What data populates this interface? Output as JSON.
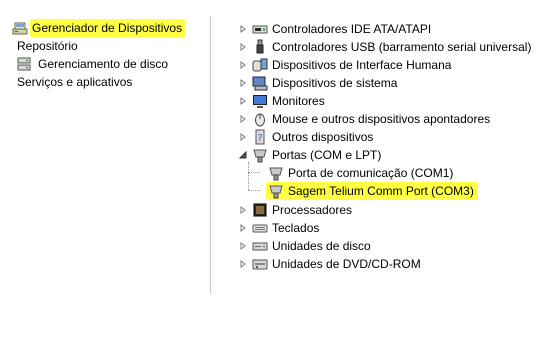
{
  "left_panel": {
    "items": [
      {
        "label": "Gerenciador de Dispositivos",
        "icon": "device-manager-icon",
        "selected": true
      },
      {
        "label": "Repositório",
        "icon": null
      },
      {
        "label": "Gerenciamento de disco",
        "icon": "disk-management-icon"
      },
      {
        "label": "Serviços e aplicativos",
        "icon": null
      }
    ]
  },
  "device_tree": {
    "categories": [
      {
        "label": "Controladores IDE ATA/ATAPI",
        "icon": "ide-controller-icon",
        "expanded": false
      },
      {
        "label": "Controladores USB (barramento serial universal)",
        "icon": "usb-icon",
        "expanded": false
      },
      {
        "label": "Dispositivos de Interface Humana",
        "icon": "hid-icon",
        "expanded": false
      },
      {
        "label": "Dispositivos de sistema",
        "icon": "system-device-icon",
        "expanded": false
      },
      {
        "label": "Monitores",
        "icon": "monitor-icon",
        "expanded": false
      },
      {
        "label": "Mouse e outros dispositivos apontadores",
        "icon": "mouse-icon",
        "expanded": false
      },
      {
        "label": "Outros dispositivos",
        "icon": "unknown-device-icon",
        "expanded": false
      },
      {
        "label": "Portas (COM e LPT)",
        "icon": "port-icon",
        "expanded": true
      },
      {
        "label": "Porta de comunicação (COM1)",
        "icon": "port-icon",
        "child": true
      },
      {
        "label": "Sagem Telium Comm Port (COM3)",
        "icon": "port-icon",
        "child": true,
        "highlighted": true
      },
      {
        "label": "Processadores",
        "icon": "processor-icon",
        "expanded": false
      },
      {
        "label": "Teclados",
        "icon": "keyboard-icon",
        "expanded": false
      },
      {
        "label": "Unidades de disco",
        "icon": "disk-drive-icon",
        "expanded": false
      },
      {
        "label": "Unidades de DVD/CD-ROM",
        "icon": "dvd-drive-icon",
        "expanded": false
      }
    ]
  },
  "colors": {
    "highlight": "#ffff44"
  }
}
